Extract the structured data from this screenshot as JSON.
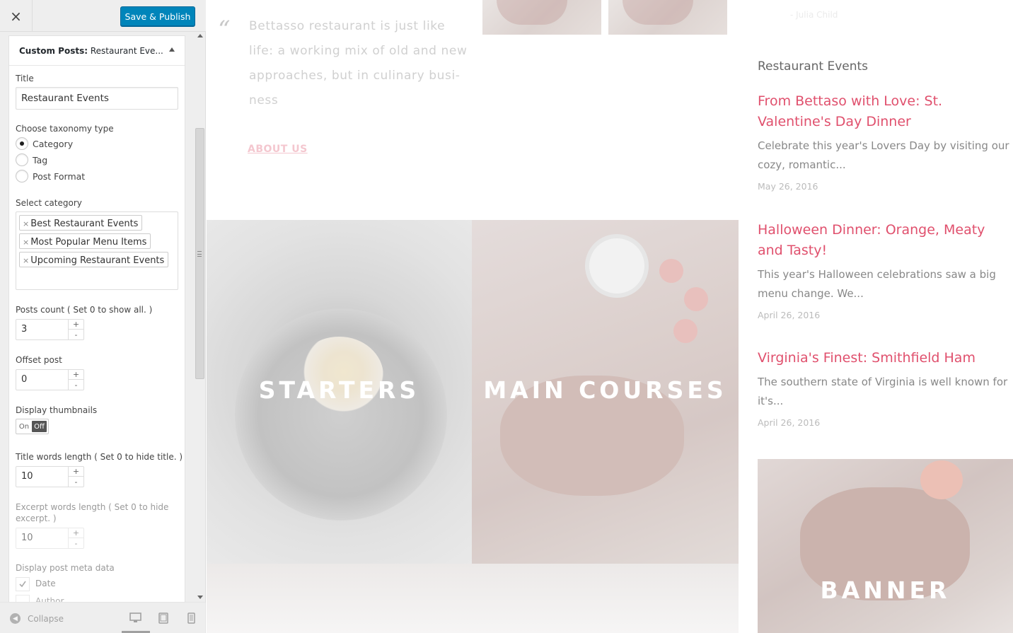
{
  "header": {
    "close_label": "×",
    "publish_label": "Save & Publish"
  },
  "section": {
    "type_label": "Custom Posts:",
    "name": "Restaurant Eve..."
  },
  "fields": {
    "title_label": "Title",
    "title_value": "Restaurant Events",
    "taxonomy_label": "Choose taxonomy type",
    "taxonomy_options": [
      "Category",
      "Tag",
      "Post Format"
    ],
    "taxonomy_selected": "Category",
    "category_label": "Select category",
    "categories": [
      "Best Restaurant Events",
      "Most Popular Menu Items",
      "Upcoming Restaurant Events"
    ],
    "tag_remove": "×",
    "posts_count_label": "Posts count ( Set 0 to show all. )",
    "posts_count": "3",
    "offset_label": "Offset post",
    "offset": "0",
    "thumbnails_label": "Display thumbnails",
    "toggle_on": "On",
    "toggle_off": "Off",
    "title_len_label": "Title words length ( Set 0 to hide title. )",
    "title_len": "10",
    "excerpt_len_label_1": "Excerpt words length ( Set 0 to hide",
    "excerpt_len_label_2": "excerpt. )",
    "excerpt_len": "10",
    "meta_label": "Display post meta data",
    "meta_date": "Date",
    "meta_author": "Author",
    "stepper_plus": "+",
    "stepper_minus": "-"
  },
  "footer": {
    "collapse_label": "Collapse"
  },
  "preview": {
    "quote_mark": "“",
    "quote": "Bettasso restaurant is just like life: a working mix of old and new approaches, but in culinary busi-ness",
    "about_link": "ABOUT US",
    "quote_cite": "- Julia Child",
    "tiles": [
      "STARTERS",
      "MAIN COURSES"
    ],
    "widget_title": "Restaurant Events",
    "posts": [
      {
        "title": "From Bettaso with Love: St. Valentine's Day Dinner",
        "excerpt": "Celebrate this year's Lovers Day by visiting our cozy, romantic...",
        "date": "May 26, 2016"
      },
      {
        "title": "Halloween Dinner: Orange, Meaty and Tasty!",
        "excerpt": "This year's Halloween celebrations saw a big menu change. We...",
        "date": "April 26, 2016"
      },
      {
        "title": "Virginia's Finest: Smithfield Ham",
        "excerpt": "The southern state of Virginia is well known for it's...",
        "date": "April 26, 2016"
      }
    ],
    "banner_label": "BANNER"
  },
  "icons": {
    "close": "close-icon",
    "collapse": "collapse-arrow-icon",
    "desktop": "desktop-icon",
    "tablet": "tablet-icon",
    "mobile": "mobile-icon",
    "quote": "quote-icon"
  },
  "colors": {
    "publish": "#0085ba",
    "accent": "#e0506d",
    "sidebar_bg": "#eeeeee"
  }
}
